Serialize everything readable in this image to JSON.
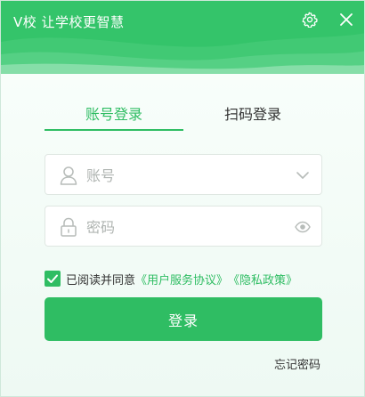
{
  "app": {
    "title": "V校 让学校更智慧"
  },
  "header": {
    "settings_icon": "gear-icon",
    "close_icon": "close-icon"
  },
  "tabs": [
    {
      "label": "账号登录",
      "active": true
    },
    {
      "label": "扫码登录",
      "active": false
    }
  ],
  "form": {
    "account": {
      "placeholder": "账号",
      "value": ""
    },
    "password": {
      "placeholder": "密码",
      "value": ""
    }
  },
  "agreement": {
    "checked": true,
    "prefix": "已阅读并同意",
    "service_link": "《用户服务协议》",
    "privacy_link": "《隐私政策》"
  },
  "login_button": "登录",
  "forgot_password": "忘记密码",
  "colors": {
    "brand": "#2fbd63",
    "header": "#34c46a"
  }
}
